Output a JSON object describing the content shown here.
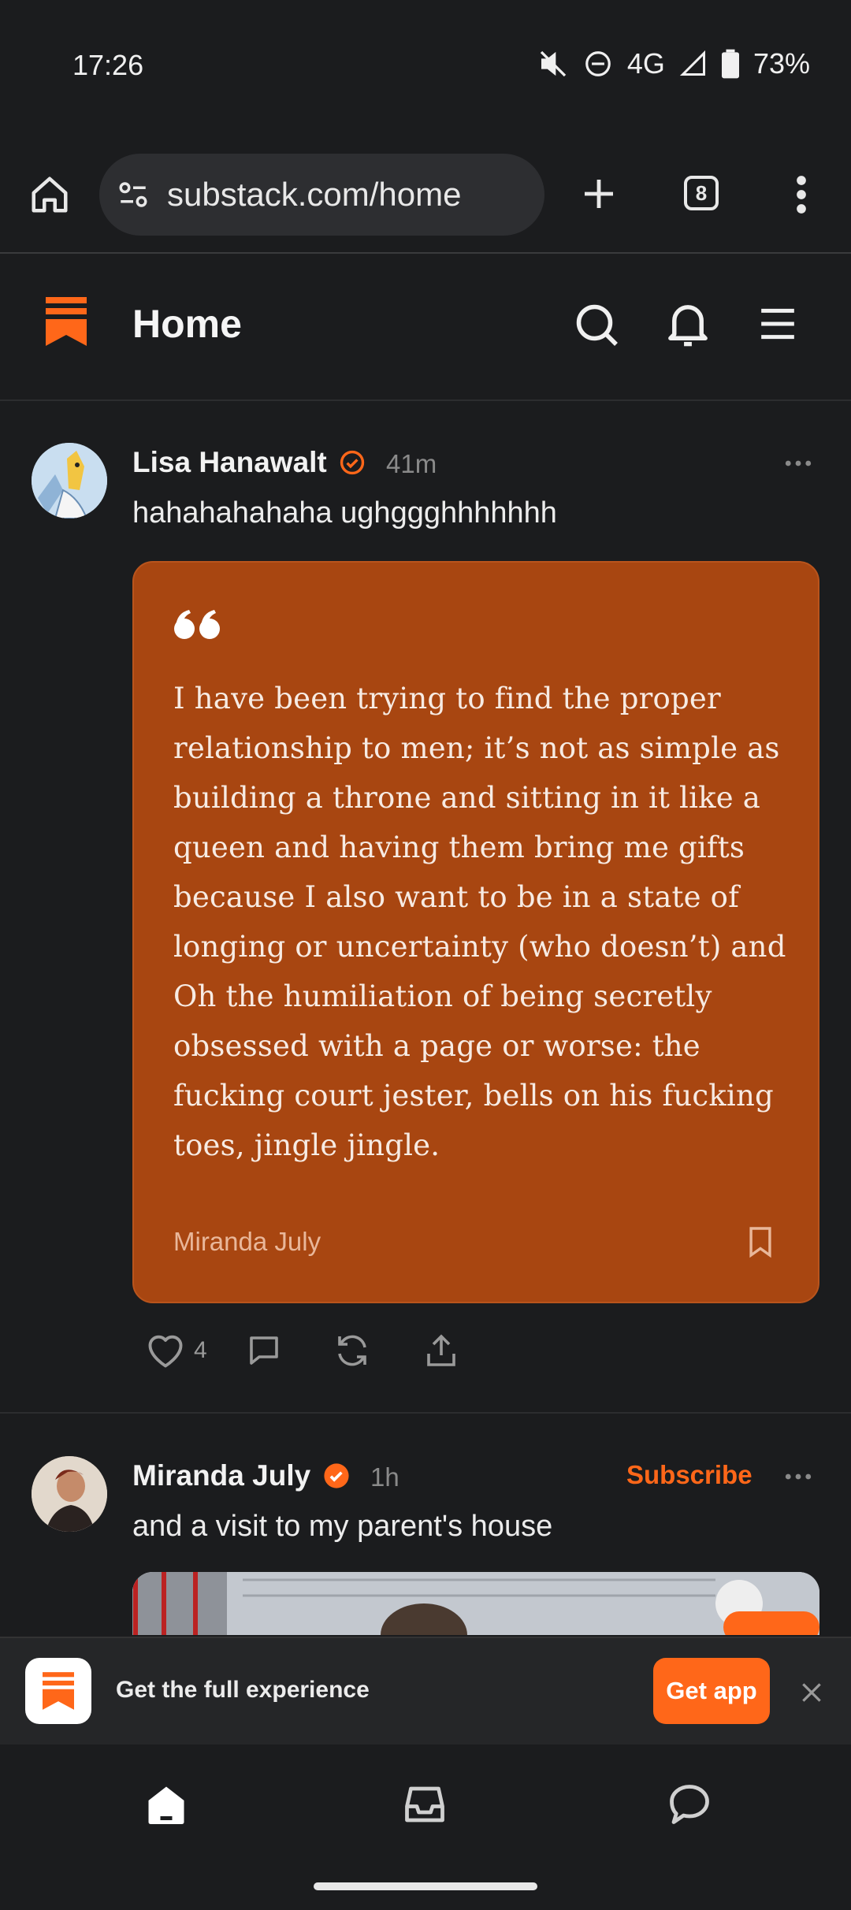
{
  "status": {
    "time": "17:26",
    "network": "4G",
    "battery": "73%"
  },
  "browser": {
    "url": "substack.com/home",
    "tab_count": "8"
  },
  "header": {
    "title": "Home"
  },
  "posts": [
    {
      "author": "Lisa Hanawalt",
      "time": "41m",
      "text": "hahahahahaha ughggghhhhhhh",
      "quote": {
        "lines": [
          "I have been trying to find the proper",
          "relationship to men; it’s not as simple as",
          "building a throne and sitting in it like a",
          "queen and having them bring me gifts",
          "because I also want to be in a state of",
          "longing or uncertainty (who doesn’t) and",
          "Oh the humiliation of being secretly",
          "obsessed with a page or worse: the",
          "fucking court jester, bells on his fucking",
          "toes, jingle jingle."
        ],
        "author": "Miranda July"
      },
      "likes": "4"
    },
    {
      "author": "Miranda July",
      "time": "1h",
      "subscribe_label": "Subscribe",
      "text": "and a visit to my parent's house"
    }
  ],
  "banner": {
    "text": "Get the full experience",
    "button": "Get app"
  },
  "colors": {
    "accent": "#ff6719",
    "quote_bg": "#a84611",
    "background": "#1b1c1e"
  },
  "icons": [
    "home-icon",
    "site-settings-icon",
    "new-tab-icon",
    "tabs-icon",
    "more-vert-icon",
    "substack-logo-icon",
    "search-icon",
    "bell-icon",
    "menu-icon",
    "verified-icon",
    "more-horiz-icon",
    "quote-icon",
    "bookmark-icon",
    "heart-icon",
    "comment-icon",
    "restack-icon",
    "share-icon",
    "close-icon",
    "inbox-icon",
    "chat-icon"
  ]
}
